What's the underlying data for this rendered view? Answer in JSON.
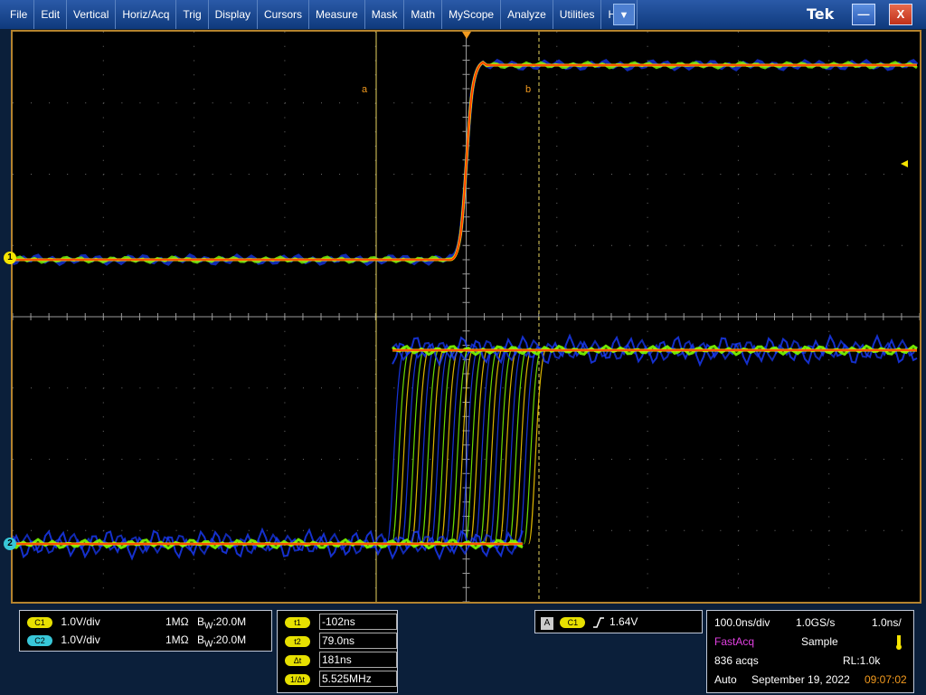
{
  "menu": {
    "items": [
      "File",
      "Edit",
      "Vertical",
      "Horiz/Acq",
      "Trig",
      "Display",
      "Cursors",
      "Measure",
      "Mask",
      "Math",
      "MyScope",
      "Analyze",
      "Utilities",
      "Help"
    ],
    "dropdown_glyph": "▼",
    "brand": "Tek",
    "minimize_glyph": "—",
    "close_glyph": "X"
  },
  "scope": {
    "cursor_a_label": "a",
    "cursor_b_label": "b",
    "ch1_marker": "1",
    "ch2_marker": "2",
    "colors": {
      "ch1": "#f5e400",
      "ch2": "#38c7d8",
      "cursor": "#f39a1e",
      "grid": "#6e6e6e",
      "trace_hot": "#ff2a00",
      "trace_warm": "#ffd400",
      "trace_mid": "#7cff00",
      "trace_cold": "#1a3cff"
    }
  },
  "channels": {
    "c1": {
      "tag": "C1",
      "scale": "1.0V/div",
      "impedance": "1MΩ",
      "bw_prefix": "B",
      "bw_sub": "W",
      "bw_value": ":20.0M"
    },
    "c2": {
      "tag": "C2",
      "scale": "1.0V/div",
      "impedance": "1MΩ",
      "bw_prefix": "B",
      "bw_sub": "W",
      "bw_value": ":20.0M"
    }
  },
  "cursors": {
    "t1": {
      "tag": "t1",
      "value": "-102ns"
    },
    "t2": {
      "tag": "t2",
      "value": "79.0ns"
    },
    "dt": {
      "tag": "Δt",
      "value": "181ns"
    },
    "inv_dt": {
      "tag": "1/Δt",
      "value": "5.525MHz"
    }
  },
  "trigger": {
    "source_box": "A",
    "channel": "C1",
    "edge_icon": "rising-edge-icon",
    "level": "1.64V"
  },
  "acquisition": {
    "time_div": "100.0ns/div",
    "sample_rate": "1.0GS/s",
    "resolution": "1.0ns/",
    "mode": "FastAcq",
    "sample": "Sample",
    "acqs": "836 acqs",
    "record_length": "RL:1.0k",
    "trigger_mode": "Auto",
    "date": "September 19, 2022",
    "time": "09:07:02"
  }
}
